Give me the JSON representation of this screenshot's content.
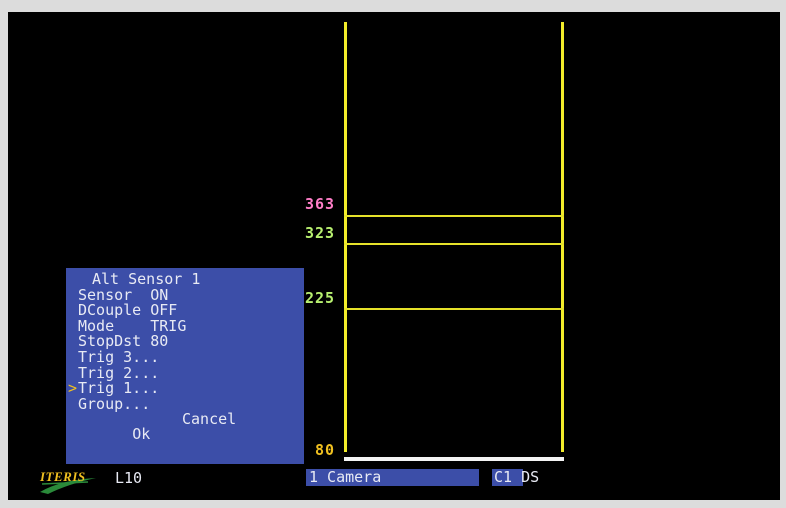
{
  "menu": {
    "title": "Alt Sensor 1",
    "items": [
      {
        "label": "Sensor  ",
        "value": "ON"
      },
      {
        "label": "DCouple ",
        "value": "OFF"
      },
      {
        "label": "Mode    ",
        "value": "TRIG"
      },
      {
        "label": "StopDst ",
        "value": "80"
      },
      {
        "label": "Trig 3...",
        "value": ""
      },
      {
        "label": "Trig 2...",
        "value": ""
      },
      {
        "label": "Trig 1...",
        "value": ""
      },
      {
        "label": "Group...",
        "value": ""
      }
    ],
    "cursor_glyph": ">",
    "ok_label": "Ok",
    "cancel_label": "Cancel"
  },
  "zone": {
    "distance_labels": [
      "363",
      "323",
      "225",
      "80"
    ]
  },
  "status_bar": {
    "logo_text": "ITERIS",
    "lane": "L10",
    "camera": "1 Camera",
    "channel": "C1",
    "mode": "DS"
  },
  "colors": {
    "background": "#000000",
    "menu_panel": "#3c4ea8",
    "lane_lines": "#f2ec2a",
    "distance_363": "#ff7ec8",
    "distance_323": "#b8f070",
    "distance_225": "#b8f070",
    "distance_80": "#f0c020"
  }
}
